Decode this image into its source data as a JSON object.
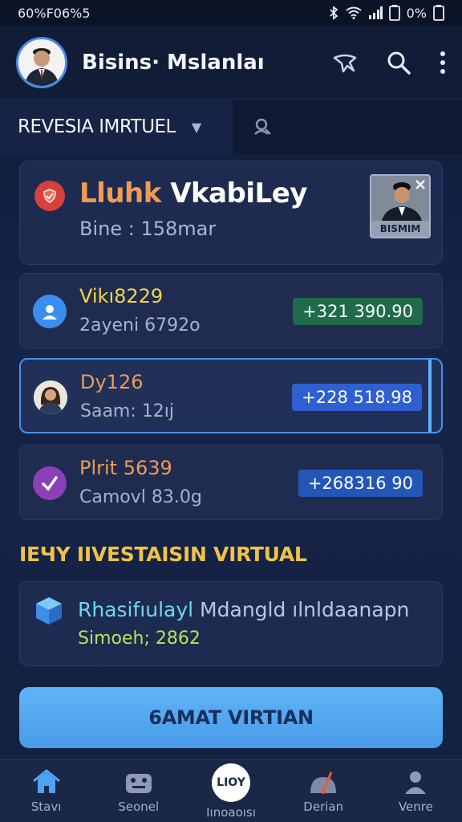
{
  "status_bar": {
    "left_text": "60%F06%5",
    "battery_text": "0%"
  },
  "app_bar": {
    "title": "Bisins· Mslanlaı"
  },
  "filter": {
    "select_label": "REVESIA IMRTUEL"
  },
  "profile": {
    "name_first": "Lluhk",
    "name_rest": "VkabiLey",
    "subtitle": "Bine : 158mar",
    "photo_label": "BISMIM"
  },
  "transactions": [
    {
      "title": "Vikı8229",
      "subtitle": "2ayeni 6792o",
      "amount": "+321 390.90",
      "title_color": "#f2d648",
      "amount_color": "#1f6b4a"
    },
    {
      "title": "Dy126",
      "subtitle": "Saam: 12ıj",
      "amount": "+228 518.98",
      "title_color": "#f09a58",
      "amount_color": "#2f5fd0"
    },
    {
      "title": "Plrit 5639",
      "subtitle": "Camovl 83.0g",
      "amount": "+268316 90",
      "title_color": "#f09a58",
      "amount_color": "#2456b8"
    }
  ],
  "invest": {
    "section_title": "IEЧY IIVESTAISIN VIRTUAL",
    "title_highlight": "Rhasifıulayl",
    "title_rest": " Mdangld ılnldaanapn",
    "subtitle": "Simoeh; 2862"
  },
  "cta": {
    "label": "6AMAT VIRTIAN"
  },
  "bottom_nav": [
    {
      "label": "Stavı"
    },
    {
      "label": "Seonel"
    },
    {
      "label": "Iınoaoısı",
      "badge": "LIOY"
    },
    {
      "label": "Derian"
    },
    {
      "label": "Venre"
    }
  ]
}
